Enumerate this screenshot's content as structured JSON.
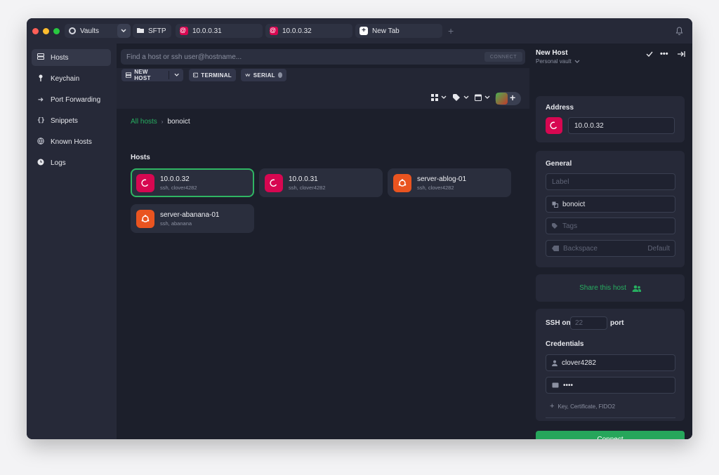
{
  "tabs": {
    "vaults": "Vaults",
    "sftp": "SFTP",
    "tab1": "10.0.0.31",
    "tab2": "10.0.0.32",
    "new_tab": "New Tab"
  },
  "sidebar": {
    "items": [
      {
        "label": "Hosts",
        "icon": "hosts-icon"
      },
      {
        "label": "Keychain",
        "icon": "key-icon"
      },
      {
        "label": "Port Forwarding",
        "icon": "forward-icon"
      },
      {
        "label": "Snippets",
        "icon": "braces-icon"
      },
      {
        "label": "Known Hosts",
        "icon": "known-hosts-icon"
      },
      {
        "label": "Logs",
        "icon": "clock-icon"
      }
    ]
  },
  "search": {
    "placeholder": "Find a host or ssh user@hostname...",
    "connect_label": "CONNECT"
  },
  "toolbar": {
    "new_host": "NEW HOST",
    "terminal": "TERMINAL",
    "serial": "SERIAL"
  },
  "breadcrumb": {
    "root": "All hosts",
    "current": "bonoict"
  },
  "hosts_title": "Hosts",
  "hosts": [
    {
      "name": "10.0.0.32",
      "sub": "ssh, clover4282",
      "os": "debian"
    },
    {
      "name": "10.0.0.31",
      "sub": "ssh, clover4282",
      "os": "debian"
    },
    {
      "name": "server-ablog-01",
      "sub": "ssh, clover4282",
      "os": "ubuntu"
    },
    {
      "name": "server-abanana-01",
      "sub": "ssh, abanana",
      "os": "ubuntu"
    }
  ],
  "panel": {
    "title": "New Host",
    "vault": "Personal vault",
    "address_label": "Address",
    "address_value": "10.0.0.32",
    "general_label": "General",
    "label_placeholder": "Label",
    "group_value": "bonoict",
    "tags_placeholder": "Tags",
    "backspace_label": "Backspace",
    "backspace_value": "Default",
    "share_label": "Share this host",
    "ssh_on": "SSH on",
    "port_value": "22",
    "port_label": "port",
    "credentials_label": "Credentials",
    "username": "clover4282",
    "password": "••••",
    "key_hint": "Key, Certificate, FIDO2",
    "connect": "Connect"
  },
  "colors": {
    "accent_green": "#26a65b",
    "debian": "#d70751",
    "ubuntu": "#e95420"
  }
}
